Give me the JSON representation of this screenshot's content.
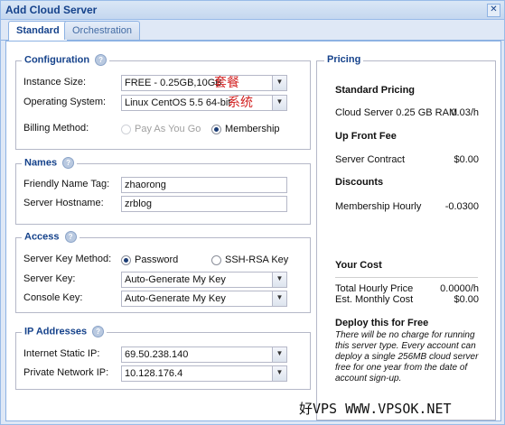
{
  "window": {
    "title": "Add Cloud Server",
    "close_glyph": "✕"
  },
  "tabs": [
    {
      "label": "Standard",
      "active": true
    },
    {
      "label": "Orchestration",
      "active": false
    }
  ],
  "configuration": {
    "legend": "Configuration",
    "instance_size": {
      "label": "Instance Size:",
      "value": "FREE - 0.25GB,10GB",
      "annotation": "套餐"
    },
    "operating_system": {
      "label": "Operating System:",
      "value": "Linux CentOS 5.5 64-bit",
      "annotation": "系统"
    },
    "billing_method": {
      "label": "Billing Method:",
      "options": [
        {
          "label": "Pay As You Go",
          "checked": false,
          "disabled": true
        },
        {
          "label": "Membership",
          "checked": true,
          "disabled": false
        }
      ]
    }
  },
  "names": {
    "legend": "Names",
    "friendly_name_tag": {
      "label": "Friendly Name Tag:",
      "value": "zhaorong"
    },
    "server_hostname": {
      "label": "Server Hostname:",
      "value": "zrblog"
    }
  },
  "access": {
    "legend": "Access",
    "server_key_method": {
      "label": "Server Key Method:",
      "options": [
        {
          "label": "Password",
          "checked": true
        },
        {
          "label": "SSH-RSA Key",
          "checked": false
        }
      ]
    },
    "server_key": {
      "label": "Server Key:",
      "value": "Auto-Generate My Key"
    },
    "console_key": {
      "label": "Console Key:",
      "value": "Auto-Generate My Key"
    }
  },
  "ip_addresses": {
    "legend": "IP Addresses",
    "internet_static_ip": {
      "label": "Internet Static IP:",
      "value": "69.50.238.140"
    },
    "private_network_ip": {
      "label": "Private Network IP:",
      "value": "10.128.176.4"
    }
  },
  "pricing": {
    "legend": "Pricing",
    "standard_pricing": {
      "heading": "Standard Pricing",
      "label": "Cloud Server 0.25 GB RAM",
      "value": "0.03/h"
    },
    "up_front_fee": {
      "heading": "Up Front Fee",
      "label": "Server Contract",
      "value": "$0.00"
    },
    "discounts": {
      "heading": "Discounts",
      "label": "Membership Hourly",
      "value": "-0.0300"
    },
    "your_cost": {
      "heading": "Your Cost",
      "total_label": "Total Hourly Price",
      "total_value": "0.0000/h",
      "monthly_label": "Est. Monthly Cost",
      "monthly_value": "$0.00"
    },
    "deploy_free": {
      "heading": "Deploy this for Free",
      "text": "There will be no charge for running this server type. Every account can deploy a single 256MB cloud server free for one year from the date of account sign-up."
    }
  },
  "watermark": "好VPS WWW.VPSOK.NET",
  "icons": {
    "help": "help-icon",
    "dropdown": "chevron-down-icon",
    "close": "close-icon"
  },
  "colors": {
    "title": "#15428b",
    "window_border": "#99bbe8",
    "annotation": "#d22020"
  }
}
